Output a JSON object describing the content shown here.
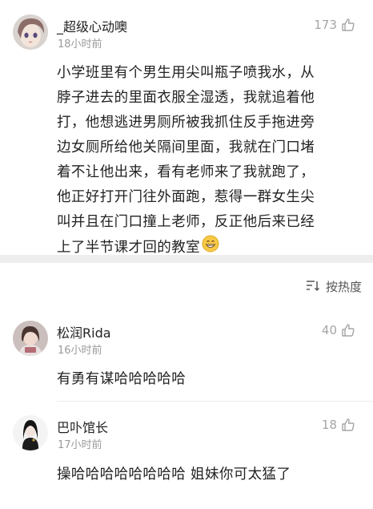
{
  "post": {
    "username": "_超级心动噢",
    "time": "18小时前",
    "likes": "173",
    "lines": [
      "小学班里有个男生用尖叫瓶子喷我水，从",
      "脖子进去的里面衣服全湿透，我就追着他",
      "打，他想逃进男厕所被我抓住反手拖进旁",
      "边女厕所给他关隔间里面，我就在门口堵",
      "着不让他出来，看有老师来了我就跑了，",
      "他正好打开门往外面跑，惹得一群女生尖",
      "叫并且在门口撞上老师，反正他后来已经",
      "上了半节课才回的教室"
    ],
    "emoji_icon": "grinning-face-emoji"
  },
  "sort": {
    "label": "按热度",
    "icon": "sort-icon"
  },
  "comments": [
    {
      "username": "松润Rida",
      "time": "16小时前",
      "likes": "40",
      "text": "有勇有谋哈哈哈哈哈"
    },
    {
      "username": "巴卟馆长",
      "time": "17小时前",
      "likes": "18",
      "text": "操哈哈哈哈哈哈哈哈 姐妹你可太猛了"
    }
  ],
  "colors": {
    "divider": "#eeeeee",
    "meta": "#9a9a9a",
    "like": "#a5a5a5"
  }
}
